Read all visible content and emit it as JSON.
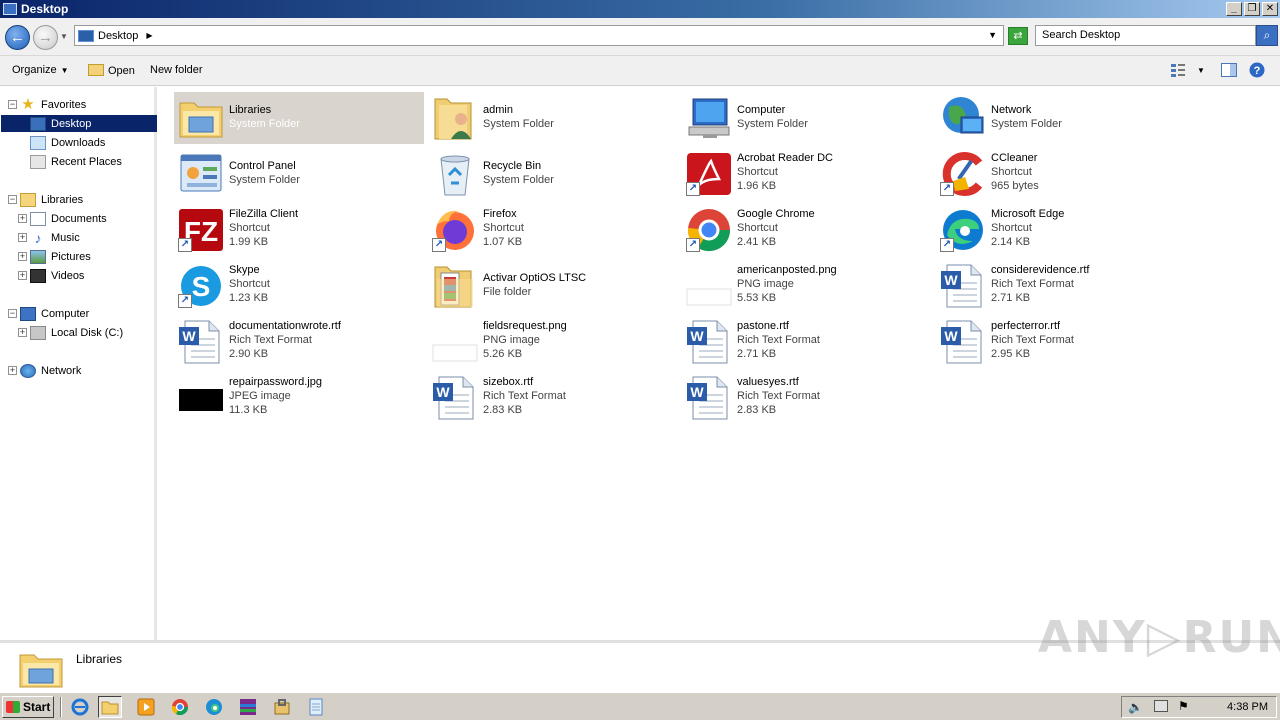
{
  "window": {
    "title": "Desktop"
  },
  "address": {
    "location": "Desktop",
    "search_placeholder": "Search Desktop"
  },
  "toolbar": {
    "organize": "Organize",
    "open": "Open",
    "new_folder": "New folder"
  },
  "nav": {
    "favorites": "Favorites",
    "desktop": "Desktop",
    "downloads": "Downloads",
    "recent_places": "Recent Places",
    "libraries": "Libraries",
    "documents": "Documents",
    "music": "Music",
    "pictures": "Pictures",
    "videos": "Videos",
    "computer": "Computer",
    "local_disk": "Local Disk (C:)",
    "network": "Network"
  },
  "items": [
    {
      "name": "Libraries",
      "line2": "System Folder",
      "line3": "",
      "icon": "library-folder-icon",
      "shortcut": false,
      "selected": true
    },
    {
      "name": "admin",
      "line2": "System Folder",
      "line3": "",
      "icon": "user-folder-icon",
      "shortcut": false
    },
    {
      "name": "Computer",
      "line2": "System Folder",
      "line3": "",
      "icon": "computer-icon",
      "shortcut": false
    },
    {
      "name": "Network",
      "line2": "System Folder",
      "line3": "",
      "icon": "network-icon",
      "shortcut": false
    },
    {
      "name": "Control Panel",
      "line2": "System Folder",
      "line3": "",
      "icon": "control-panel-icon",
      "shortcut": false
    },
    {
      "name": "Recycle Bin",
      "line2": "System Folder",
      "line3": "",
      "icon": "recycle-bin-icon",
      "shortcut": false
    },
    {
      "name": "Acrobat Reader DC",
      "line2": "Shortcut",
      "line3": "1.96 KB",
      "icon": "acrobat-icon",
      "shortcut": true
    },
    {
      "name": "CCleaner",
      "line2": "Shortcut",
      "line3": "965 bytes",
      "icon": "ccleaner-icon",
      "shortcut": true
    },
    {
      "name": "FileZilla Client",
      "line2": "Shortcut",
      "line3": "1.99 KB",
      "icon": "filezilla-icon",
      "shortcut": true
    },
    {
      "name": "Firefox",
      "line2": "Shortcut",
      "line3": "1.07 KB",
      "icon": "firefox-icon",
      "shortcut": true
    },
    {
      "name": "Google Chrome",
      "line2": "Shortcut",
      "line3": "2.41 KB",
      "icon": "chrome-icon",
      "shortcut": true
    },
    {
      "name": "Microsoft Edge",
      "line2": "Shortcut",
      "line3": "2.14 KB",
      "icon": "edge-icon",
      "shortcut": true
    },
    {
      "name": "Skype",
      "line2": "Shortcut",
      "line3": "1.23 KB",
      "icon": "skype-icon",
      "shortcut": true
    },
    {
      "name": "Activar OptiOS LTSC",
      "line2": "File folder",
      "line3": "",
      "icon": "folder-icon",
      "shortcut": false
    },
    {
      "name": "americanposted.png",
      "line2": "PNG image",
      "line3": "5.53 KB",
      "icon": "png-file-icon",
      "shortcut": false
    },
    {
      "name": "considerevidence.rtf",
      "line2": "Rich Text Format",
      "line3": "2.71 KB",
      "icon": "rtf-file-icon",
      "shortcut": false
    },
    {
      "name": "documentationwrote.rtf",
      "line2": "Rich Text Format",
      "line3": "2.90 KB",
      "icon": "rtf-file-icon",
      "shortcut": false
    },
    {
      "name": "fieldsrequest.png",
      "line2": "PNG image",
      "line3": "5.26 KB",
      "icon": "png-file-icon",
      "shortcut": false
    },
    {
      "name": "pastone.rtf",
      "line2": "Rich Text Format",
      "line3": "2.71 KB",
      "icon": "rtf-file-icon",
      "shortcut": false
    },
    {
      "name": "perfecterror.rtf",
      "line2": "Rich Text Format",
      "line3": "2.95 KB",
      "icon": "rtf-file-icon",
      "shortcut": false
    },
    {
      "name": "repairpassword.jpg",
      "line2": "JPEG image",
      "line3": "11.3 KB",
      "icon": "jpg-file-icon",
      "shortcut": false
    },
    {
      "name": "sizebox.rtf",
      "line2": "Rich Text Format",
      "line3": "2.83 KB",
      "icon": "rtf-file-icon",
      "shortcut": false
    },
    {
      "name": "valuesyes.rtf",
      "line2": "Rich Text Format",
      "line3": "2.83 KB",
      "icon": "rtf-file-icon",
      "shortcut": false
    }
  ],
  "details": {
    "name": "Libraries"
  },
  "watermark": "ANY RUN",
  "taskbar": {
    "start": "Start",
    "clock": "4:38 PM"
  }
}
